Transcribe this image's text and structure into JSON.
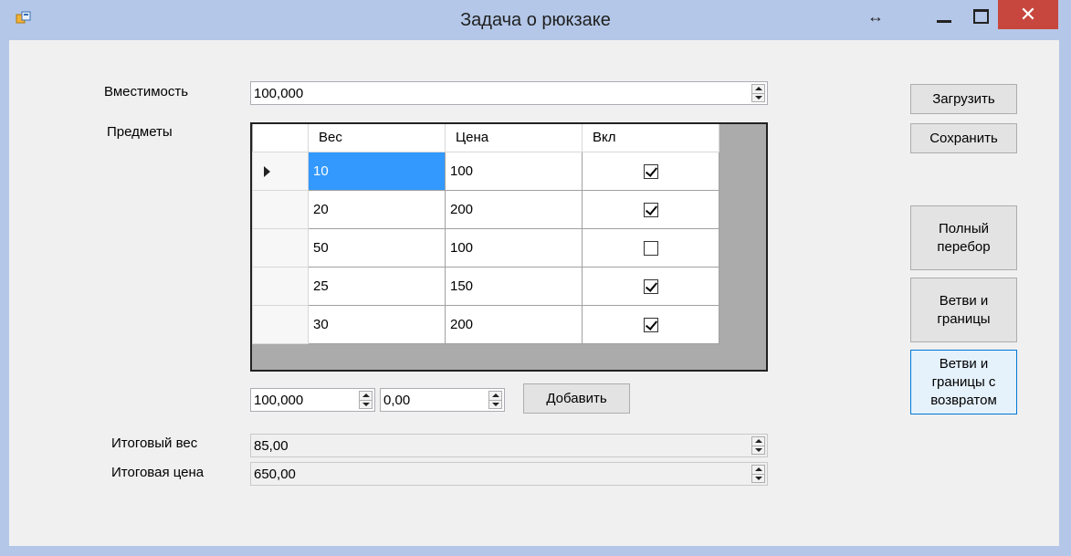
{
  "window": {
    "title": "Задача о рюкзаке",
    "close_glyph": "✕",
    "resize_glyph": "↔"
  },
  "form": {
    "capacity_label": "Вместимость",
    "capacity_value": "100,000",
    "items_label": "Предметы",
    "grid": {
      "columns": [
        "Вес",
        "Цена",
        "Вкл"
      ],
      "rows": [
        {
          "weight": "10",
          "price": "100",
          "included": true
        },
        {
          "weight": "20",
          "price": "200",
          "included": true
        },
        {
          "weight": "50",
          "price": "100",
          "included": false
        },
        {
          "weight": "25",
          "price": "150",
          "included": true
        },
        {
          "weight": "30",
          "price": "200",
          "included": true
        }
      ]
    },
    "new_weight_value": "100,000",
    "new_price_value": "0,00",
    "add_button": "Добавить",
    "total_weight_label": "Итоговый вес",
    "total_weight_value": "85,00",
    "total_price_label": "Итоговая цена",
    "total_price_value": "650,00"
  },
  "buttons": {
    "load": "Загрузить",
    "save": "Сохранить",
    "brute_force": "Полный перебор",
    "branch_bound": "Ветви и границы",
    "branch_bound_backtrack": "Ветви и границы с возвратом"
  },
  "colors": {
    "accent": "#3399ff",
    "close": "#c7463d",
    "titlebar": "#b4c7e8"
  }
}
